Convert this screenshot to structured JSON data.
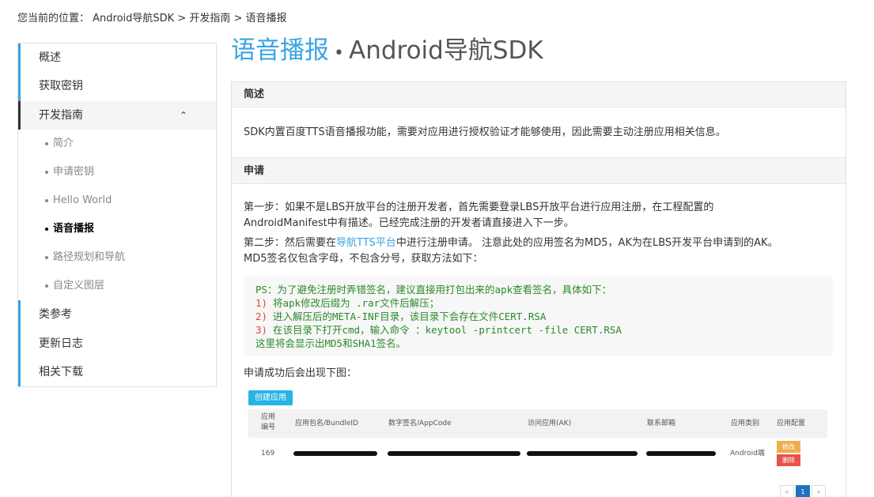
{
  "breadcrumb": "您当前的位置： Android导航SDK > 开发指南 > 语音播报",
  "sidebar": {
    "items": [
      {
        "label": "概述"
      },
      {
        "label": "获取密钥"
      },
      {
        "label": "开发指南"
      },
      {
        "label": "类参考"
      },
      {
        "label": "更新日志"
      },
      {
        "label": "相关下载"
      }
    ],
    "chevron": "⌃",
    "subitems": [
      {
        "label": "简介"
      },
      {
        "label": "申请密钥"
      },
      {
        "label": "Hello World"
      },
      {
        "label": "语音播报"
      },
      {
        "label": "路径规划和导航"
      },
      {
        "label": "自定义图层"
      }
    ]
  },
  "page": {
    "title": "语音播报",
    "separator": "•",
    "subtitle": "Android导航SDK"
  },
  "sections": {
    "overview": {
      "heading": "简述",
      "text": "SDK内置百度TTS语音播报功能，需要对应用进行授权验证才能够使用，因此需要主动注册应用相关信息。"
    },
    "apply": {
      "heading": "申请",
      "step1_line1": "第一步：如果不是LBS开放平台的注册开发者，首先需要登录LBS开放平台进行应用注册，在工程配置的",
      "step1_line2": "AndroidManifest中有描述。已经完成注册的开发者请直接进入下一步。",
      "step2_pre": "第二步：然后需要在",
      "step2_link": "导航TTS平台",
      "step2_post": "中进行注册申请。 注意此处的应用签名为MD5，AK为在LBS开发平台申请到的AK。",
      "step2_line2": "MD5签名仅包含字母，不包含分号，获取方法如下：",
      "code": {
        "line0": "PS：为了避免注册时弄错签名，建议直接用打包出来的apk查看签名，具体如下：",
        "lines": [
          {
            "num": "1)",
            "text": "将apk修改后缀为 .rar文件后解压；"
          },
          {
            "num": "2)",
            "text": "进入解压后的META-INF目录，该目录下会存在文件CERT.RSA"
          },
          {
            "num": "3)",
            "text": "在该目录下打开cmd，输入命令 ：keytool -printcert -file CERT.RSA"
          }
        ],
        "last": "这里将会显示出MD5和SHA1签名。"
      },
      "after_text": "申请成功后会出现下图："
    }
  },
  "screenshot": {
    "create_button": "创建应用",
    "headers": [
      "应用编号",
      "应用包名/BundleID",
      "数字签名/AppCode",
      "访问应用(AK)",
      "联系邮箱",
      "应用类别",
      "应用配置"
    ],
    "row": {
      "id": "169",
      "category": "Android端",
      "edit": "修改",
      "delete": "删除"
    },
    "pager": [
      "«",
      "1",
      "»"
    ],
    "edit_color": "#f0ad4e",
    "delete_color": "#e8524a"
  }
}
